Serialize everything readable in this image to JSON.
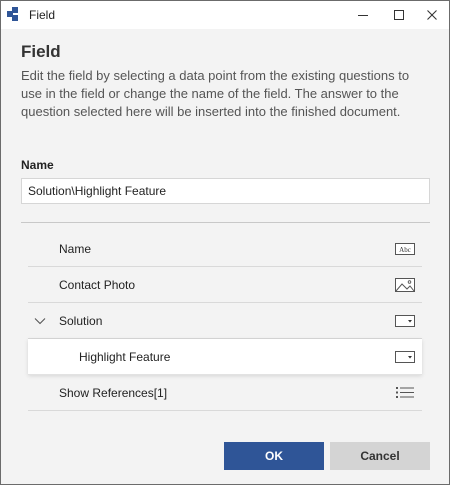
{
  "window": {
    "title": "Field",
    "app_icon": "app-logo-icon",
    "controls": [
      "minimize-icon",
      "maximize-icon",
      "close-icon"
    ]
  },
  "dialog": {
    "heading": "Field",
    "description": "Edit the field by selecting a data point from the existing questions to use in the field or change the name of the field. The answer to the question selected here will be inserted into the finished document.",
    "name_label": "Name",
    "name_value": "Solution\\Highlight Feature"
  },
  "fields": [
    {
      "label": "Name",
      "icon": "text-field-icon",
      "indent": 0,
      "expanded": null,
      "selected": false
    },
    {
      "label": "Contact Photo",
      "icon": "image-icon",
      "indent": 0,
      "expanded": null,
      "selected": false
    },
    {
      "label": "Solution",
      "icon": "dropdown-field-icon",
      "indent": 0,
      "expanded": true,
      "selected": false
    },
    {
      "label": "Highlight Feature",
      "icon": "dropdown-field-icon",
      "indent": 1,
      "expanded": null,
      "selected": true
    },
    {
      "label": "Show References[1]",
      "icon": "list-icon",
      "indent": 0,
      "expanded": null,
      "selected": false
    }
  ],
  "buttons": {
    "ok": "OK",
    "cancel": "Cancel"
  },
  "colors": {
    "primary": "#2f5597",
    "secondary": "#d4d4d4",
    "background": "#f3f3f3"
  }
}
